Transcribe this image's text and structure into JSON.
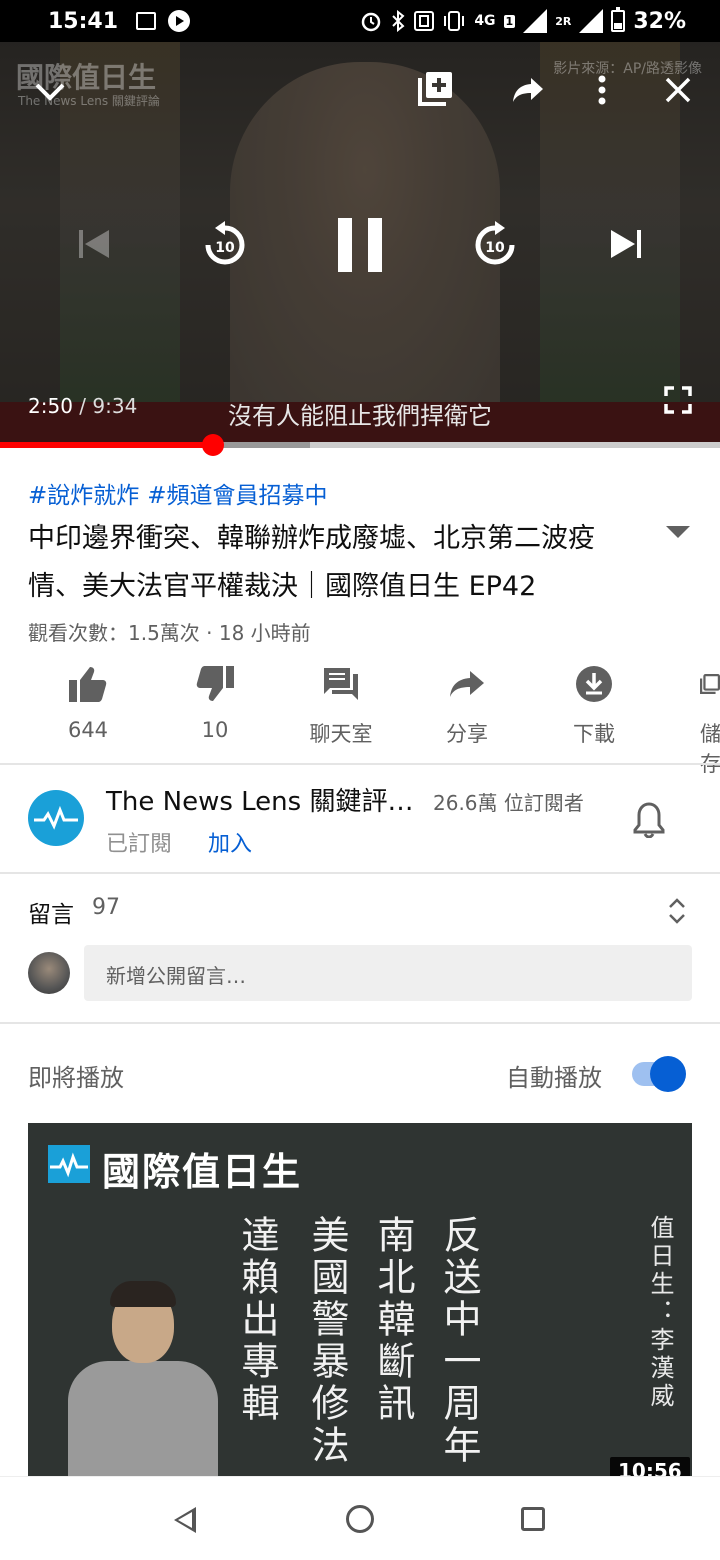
{
  "status_bar": {
    "time": "15:41",
    "network": "4G",
    "network_badge": "1",
    "network2": "2R",
    "battery": "32%",
    "battery_level": 0.32
  },
  "player": {
    "watermark_logo": "國際值日生",
    "watermark_sub": "The News Lens 關鍵評論",
    "watermark_credit": "影片來源：AP/路透影像",
    "current_time": "2:50",
    "separator": " / ",
    "total_time": "9:34",
    "subtitle": "沒有人能阻止我們捍衛它",
    "skip_back_seconds": "10",
    "skip_forward_seconds": "10",
    "progress_played": 0.296,
    "progress_buffered": 0.43
  },
  "video": {
    "hashtags": [
      "#說炸就炸",
      "#頻道會員招募中"
    ],
    "title": "中印邊界衝突、韓聯辦炸成廢墟、北京第二波疫情、美大法官平權裁決｜國際值日生 EP42",
    "meta": "觀看次數：1.5萬次 · 18 小時前"
  },
  "actions": [
    {
      "icon": "thumbs-up-icon",
      "label": "644"
    },
    {
      "icon": "thumbs-down-icon",
      "label": "10"
    },
    {
      "icon": "chat-icon",
      "label": "聊天室"
    },
    {
      "icon": "share-icon",
      "label": "分享"
    },
    {
      "icon": "download-icon",
      "label": "下載"
    },
    {
      "icon": "save-icon",
      "label": "儲存"
    }
  ],
  "channel": {
    "name": "The News Lens 關鍵評…",
    "subscribers": "26.6萬 位訂閱者",
    "subscribed": "已訂閱",
    "join": "加入"
  },
  "comments": {
    "label": "留言",
    "count": "97",
    "placeholder": "新增公開留言…"
  },
  "up_next": {
    "label": "即將播放",
    "autoplay_label": "自動播放",
    "autoplay_on": true,
    "thumbnail": {
      "logo_text": "國際值日生",
      "col1": "反送中一周年",
      "col2": "南北韓斷訊",
      "col3": "美國警暴修法",
      "col4": "達賴出專輯",
      "host": "值日生：李漢威",
      "duration": "10:56"
    }
  },
  "colors": {
    "accent_blue": "#065fd4",
    "progress_red": "#ff0000",
    "channel_blue": "#1aa0d8"
  }
}
